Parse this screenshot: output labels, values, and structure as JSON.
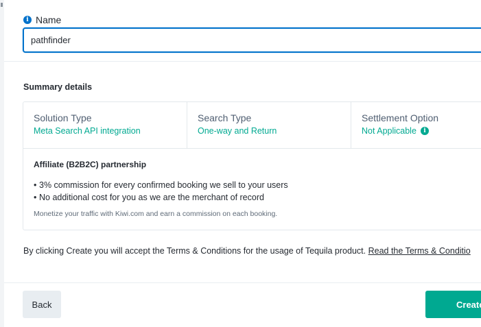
{
  "name_field": {
    "label": "Name",
    "value": "pathfinder",
    "icon": "info-icon"
  },
  "summary": {
    "title": "Summary details",
    "columns": [
      {
        "label": "Solution Type",
        "value": "Meta Search API integration"
      },
      {
        "label": "Search Type",
        "value": "One-way and Return"
      },
      {
        "label": "Settlement Option",
        "value": "Not Applicable",
        "icon": "info-icon"
      }
    ],
    "affiliate": {
      "title": "Affiliate (B2B2C) partnership",
      "bullets": [
        "3% commission for every confirmed booking we sell to your users",
        "No additional cost for you as we are the merchant of record"
      ],
      "note": "Monetize your traffic with Kiwi.com and earn a commission on each booking."
    }
  },
  "terms": {
    "text": "By clicking Create you will accept the Terms & Conditions for the usage of Tequila product.",
    "link_label": "Read the Terms & Conditio"
  },
  "actions": {
    "back_label": "Back",
    "create_label": "Create"
  },
  "colors": {
    "accent_blue": "#0172cb",
    "accent_green": "#00a991",
    "text_primary": "#252a31",
    "secondary_button_bg": "#e8edf1"
  }
}
